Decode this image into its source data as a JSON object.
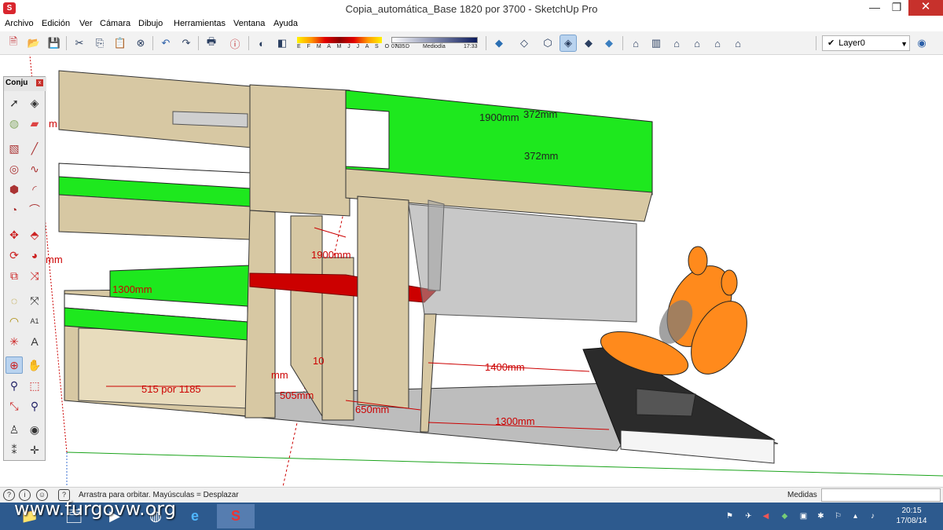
{
  "window": {
    "title": "Copia_automática_Base 1820 por 3700 - SketchUp Pro",
    "minimize": "—",
    "maximize": "❐",
    "close": "✕"
  },
  "menu": [
    "Archivo",
    "Edición",
    "Ver",
    "Cámara",
    "Dibujo",
    "Herramientas",
    "Ventana",
    "Ayuda"
  ],
  "toolbar": {
    "shadow_months": "E F M A M J J A S O N D",
    "time_start": "07:35",
    "time_mid": "Mediodía",
    "time_end": "17:33",
    "layer": "Layer0"
  },
  "palette": {
    "title": "Conju"
  },
  "viewport": {
    "dimensions": [
      "1900mm",
      "372mm",
      "372mm",
      "1900mm",
      "1300mm",
      "515 por 1185",
      "505mm",
      "650mm",
      "1400mm",
      "1300mm",
      "10",
      "mm",
      "m",
      "mm"
    ]
  },
  "status": {
    "text": "Arrastra para orbitar. Mayúsculas = Desplazar",
    "measures_label": "Medidas"
  },
  "taskbar": {
    "time": "20:15",
    "date": "17/08/14",
    "watermark": "www.furgovw.org"
  },
  "colors": {
    "wood": "#d7c8a3",
    "green": "#1ee81e",
    "red": "#cc0000",
    "seat_orange": "#ff8a1c",
    "taskbar": "#2d5a8e",
    "selection": "#b9d3ef"
  },
  "icons": {
    "toolbar": [
      "new-icon",
      "open-icon",
      "save-icon",
      "cut-icon",
      "copy-icon",
      "paste-icon",
      "erase-icon",
      "undo-icon",
      "redo-icon",
      "print-icon",
      "model-info-icon",
      "shadow-toggle-icon",
      "fog-icon",
      "xray-icon",
      "back-edges-icon",
      "wireframe-icon",
      "hidden-line-icon",
      "shaded-icon",
      "shaded-texture-icon",
      "monochrome-icon",
      "iso-view-icon",
      "top-view-icon",
      "front-view-icon",
      "right-view-icon",
      "back-view-icon",
      "left-view-icon",
      "layer-manager-icon"
    ],
    "palette": [
      "select-icon",
      "component-icon",
      "paint-icon",
      "eraser-icon",
      "rectangle-icon",
      "line-icon",
      "circle-icon",
      "arc-icon",
      "polygon-icon",
      "arc2-icon",
      "pie-icon",
      "freehand-icon",
      "move-icon",
      "push-pull-icon",
      "rotate-icon",
      "follow-me-icon",
      "scale-icon",
      "offset-icon",
      "tape-measure-icon",
      "dimension-icon",
      "protractor-icon",
      "text-icon",
      "axes-icon",
      "3d-text-icon",
      "orbit-icon",
      "pan-icon",
      "zoom-icon",
      "zoom-window-icon",
      "zoom-extents-icon",
      "previous-view-icon",
      "position-camera-icon",
      "look-around-icon",
      "walk-icon",
      "section-plane-icon"
    ]
  }
}
